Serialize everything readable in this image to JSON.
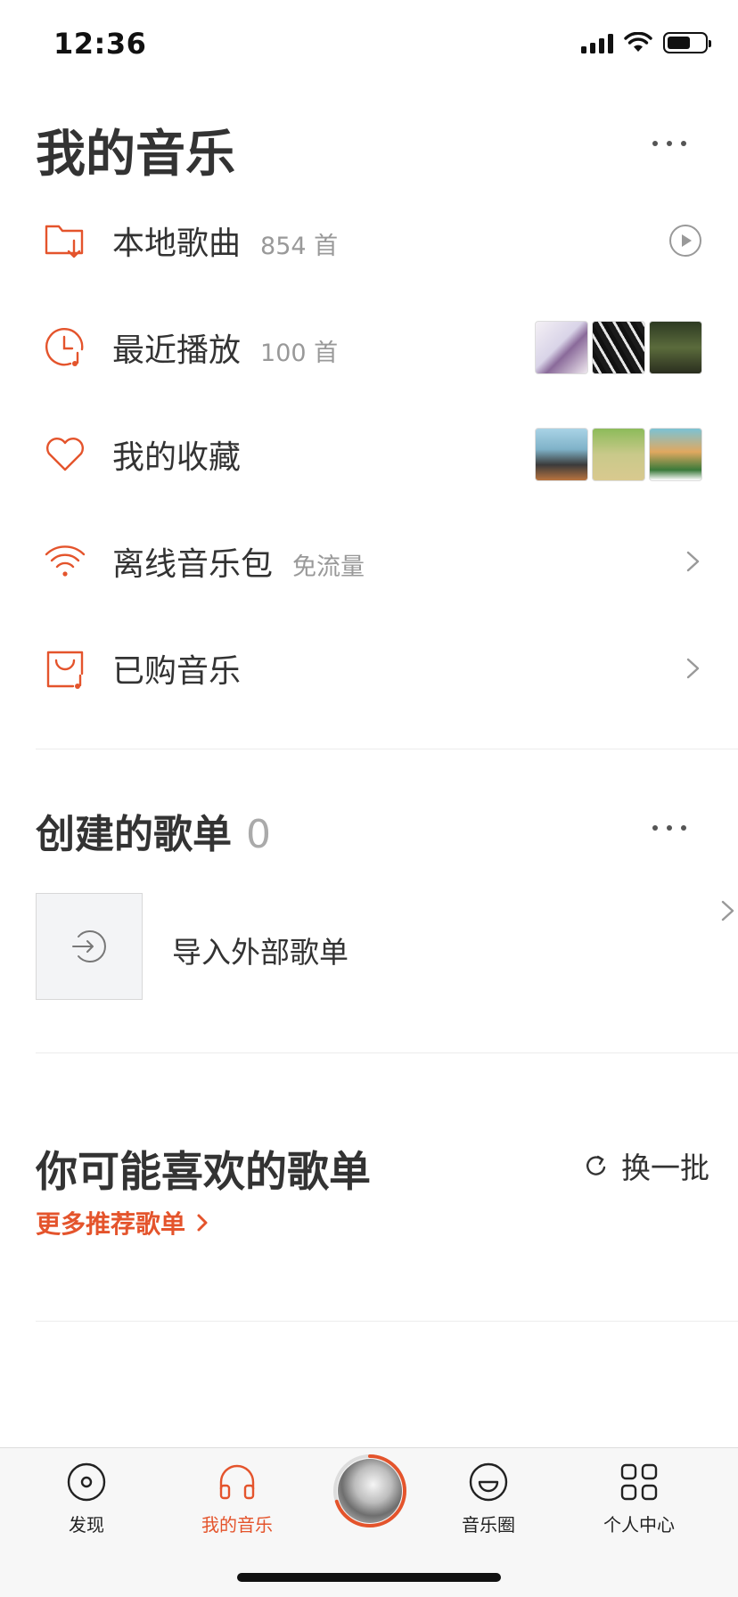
{
  "status_bar": {
    "time": "12:36"
  },
  "header": {
    "title": "我的音乐"
  },
  "menu": {
    "items": [
      {
        "label": "本地歌曲",
        "sub": "854 首",
        "icon": "folder-download-icon"
      },
      {
        "label": "最近播放",
        "sub": "100 首",
        "icon": "clock-music-icon"
      },
      {
        "label": "我的收藏",
        "sub": "",
        "icon": "heart-icon"
      },
      {
        "label": "离线音乐包",
        "sub": "免流量",
        "icon": "wifi-offline-icon"
      },
      {
        "label": "已购音乐",
        "sub": "",
        "icon": "shopping-bag-music-icon"
      }
    ]
  },
  "created_playlists": {
    "title": "创建的歌单",
    "count": "0",
    "import_label": "导入外部歌单"
  },
  "recommend": {
    "title": "你可能喜欢的歌单",
    "refresh_label": "换一批",
    "more_label": "更多推荐歌单"
  },
  "tab_bar": {
    "tabs": [
      {
        "label": "发现",
        "icon": "disc-icon"
      },
      {
        "label": "我的音乐",
        "icon": "headphones-icon",
        "active": true
      },
      {
        "label": "音乐圈",
        "icon": "smile-circle-icon"
      },
      {
        "label": "个人中心",
        "icon": "grid-icon"
      }
    ],
    "player_progress": 0.7
  },
  "colors": {
    "accent": "#e4542c",
    "text": "#333333",
    "muted": "#999999"
  }
}
